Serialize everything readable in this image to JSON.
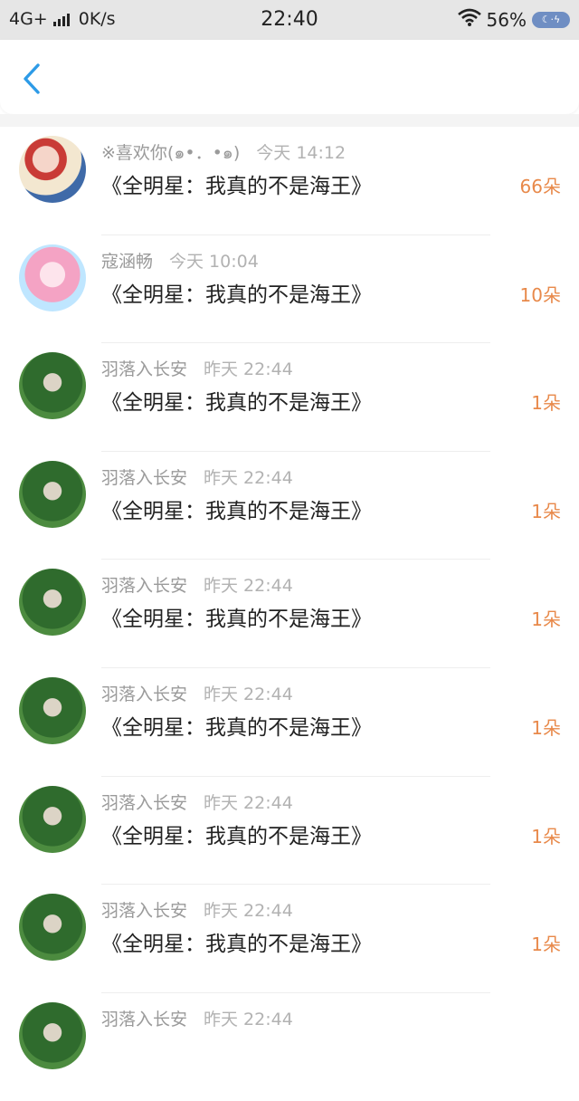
{
  "status_bar": {
    "network": "4G+",
    "speed": "0K/s",
    "time": "22:40",
    "battery_percent": "56%",
    "icons": [
      "signal-icon",
      "wifi-icon",
      "battery-icon"
    ]
  },
  "header": {
    "back_icon": "chevron-left-icon",
    "accent_color": "#2d9be7"
  },
  "list": {
    "count_color": "#e8894a",
    "items": [
      {
        "user": "※喜欢你(๑•．•๑)",
        "time": "今天 14:12",
        "title": "《全明星：我真的不是海王》",
        "count": "66朵",
        "avatar": "anime-avatar"
      },
      {
        "user": "寇涵畅",
        "time": "今天 10:04",
        "title": "《全明星：我真的不是海王》",
        "count": "10朵",
        "avatar": "pink-hair-avatar"
      },
      {
        "user": "羽落入长安",
        "time": "昨天 22:44",
        "title": "《全明星：我真的不是海王》",
        "count": "1朵",
        "avatar": "heart-hands-avatar"
      },
      {
        "user": "羽落入长安",
        "time": "昨天 22:44",
        "title": "《全明星：我真的不是海王》",
        "count": "1朵",
        "avatar": "heart-hands-avatar"
      },
      {
        "user": "羽落入长安",
        "time": "昨天 22:44",
        "title": "《全明星：我真的不是海王》",
        "count": "1朵",
        "avatar": "heart-hands-avatar"
      },
      {
        "user": "羽落入长安",
        "time": "昨天 22:44",
        "title": "《全明星：我真的不是海王》",
        "count": "1朵",
        "avatar": "heart-hands-avatar"
      },
      {
        "user": "羽落入长安",
        "time": "昨天 22:44",
        "title": "《全明星：我真的不是海王》",
        "count": "1朵",
        "avatar": "heart-hands-avatar"
      },
      {
        "user": "羽落入长安",
        "time": "昨天 22:44",
        "title": "《全明星：我真的不是海王》",
        "count": "1朵",
        "avatar": "heart-hands-avatar"
      },
      {
        "user": "羽落入长安",
        "time": "昨天 22:44",
        "title": "",
        "count": "",
        "avatar": "heart-hands-avatar"
      }
    ]
  }
}
